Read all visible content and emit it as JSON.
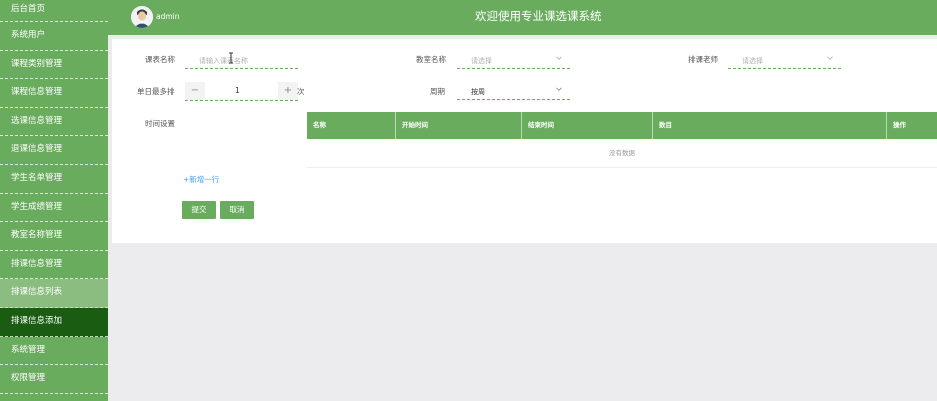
{
  "sidebar": {
    "items": [
      {
        "label": "后台首页"
      },
      {
        "label": "系统用户"
      },
      {
        "label": "课程类别管理"
      },
      {
        "label": "课程信息管理"
      },
      {
        "label": "选课信息管理"
      },
      {
        "label": "退课信息管理"
      },
      {
        "label": "学生名单管理"
      },
      {
        "label": "学生成绩管理"
      },
      {
        "label": "教室名称管理"
      },
      {
        "label": "排课信息管理"
      },
      {
        "label": "排课信息列表"
      },
      {
        "label": "排课信息添加"
      },
      {
        "label": "系统管理"
      },
      {
        "label": "权限管理"
      }
    ]
  },
  "header": {
    "username": "admin",
    "title": "欢迎使用专业课选课系统",
    "avatar_icon": "user-avatar-icon"
  },
  "form": {
    "course_name": {
      "label": "课表名称",
      "placeholder": "请输入课表名称"
    },
    "classroom": {
      "label": "教室名称",
      "placeholder": "请选择"
    },
    "teacher": {
      "label": "排课老师",
      "placeholder": "请选择"
    },
    "max_per_day": {
      "label": "单日最多排",
      "value": "1",
      "unit": "次",
      "minus": "−",
      "plus": "+"
    },
    "period": {
      "label": "周期",
      "value": "按周"
    },
    "time_settings": {
      "label": "时间设置"
    }
  },
  "table": {
    "columns": [
      "名称",
      "开始时间",
      "结束时间",
      "数目",
      "操作"
    ],
    "empty_text": "没有数据"
  },
  "actions": {
    "add_row": "+新增一行",
    "submit": "提交",
    "cancel": "取消"
  },
  "colors": {
    "primary": "#6aac5e",
    "active_menu": "#1a5c12",
    "link": "#409eff"
  }
}
